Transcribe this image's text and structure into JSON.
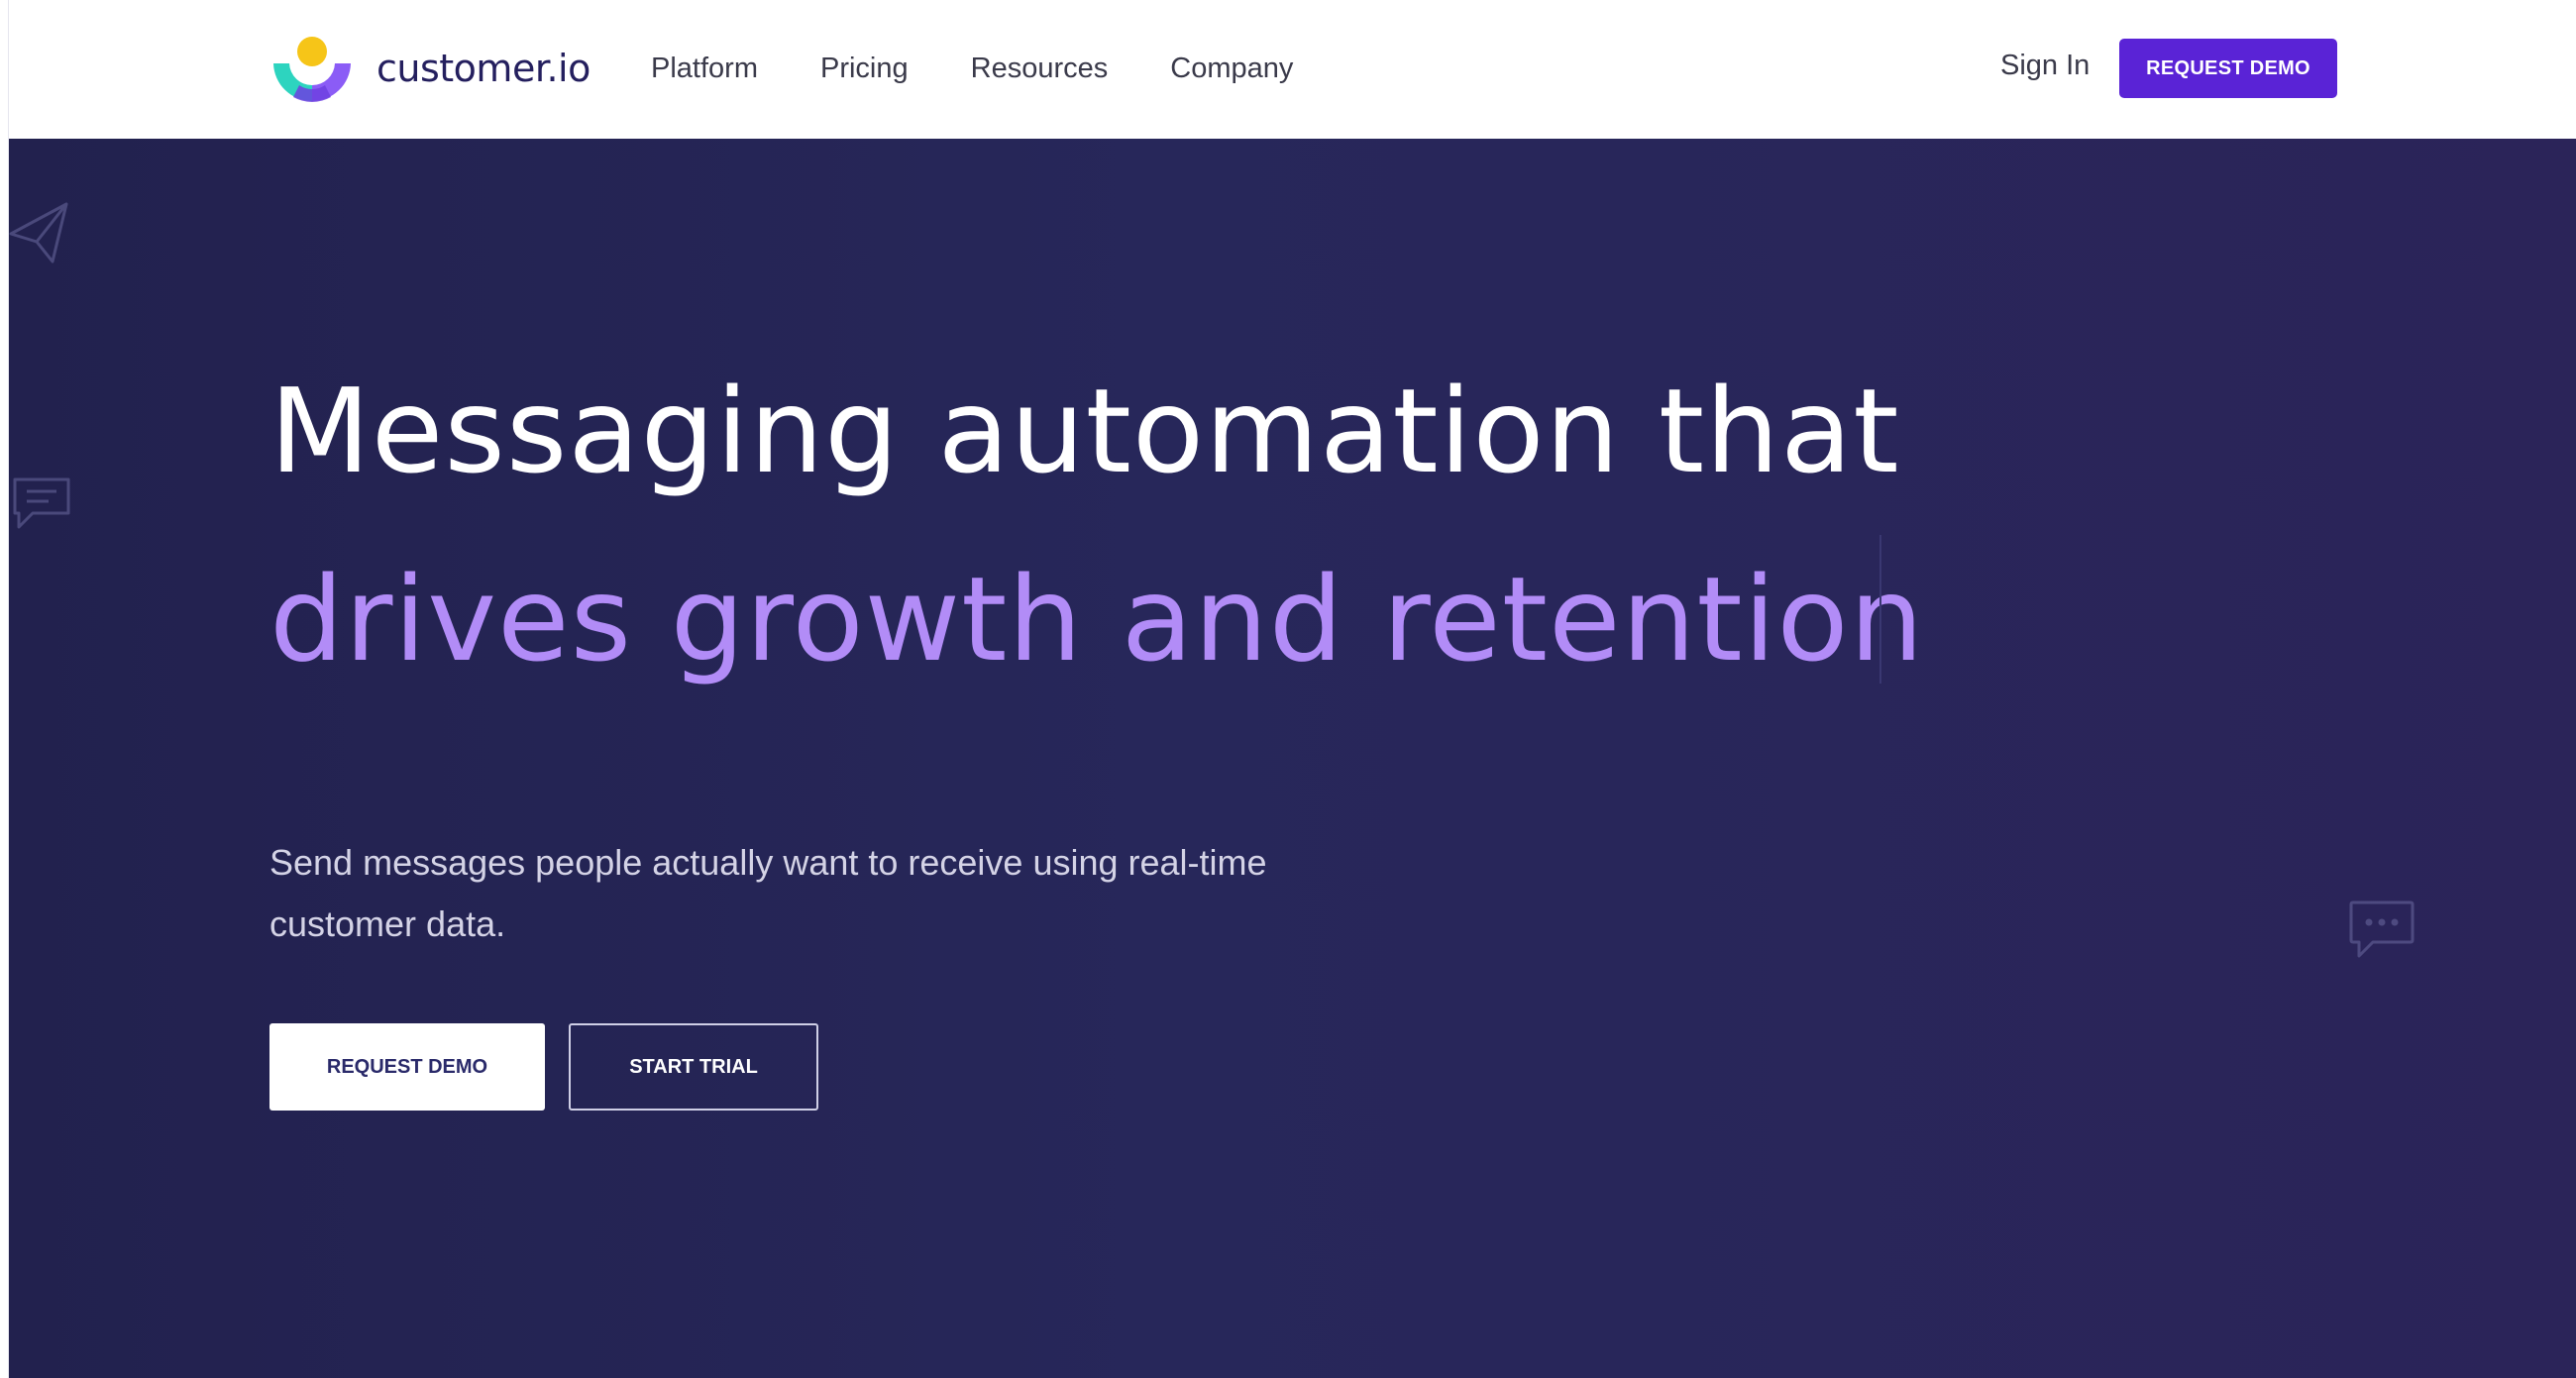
{
  "brand": {
    "name": "customer.io"
  },
  "nav": {
    "links": [
      "Platform",
      "Pricing",
      "Resources",
      "Company"
    ],
    "sign_in": "Sign In",
    "cta": "REQUEST DEMO"
  },
  "hero": {
    "headline_line1": "Messaging automation that",
    "headline_line2": "drives growth and retention",
    "subtext": "Send messages people actually want to receive using real-time customer data.",
    "primary_cta": "REQUEST DEMO",
    "secondary_cta": "START TRIAL",
    "decor_icons": [
      "paper-plane-icon",
      "chat-bubble-icon",
      "chat-dots-icon"
    ]
  },
  "colors": {
    "brand_purple": "#5a23d6",
    "hero_bg": "#27275a",
    "headline_accent": "#b28cf7",
    "logo_yellow": "#f6c518",
    "logo_teal": "#2dd4bf",
    "logo_purple": "#8b5cf6"
  }
}
